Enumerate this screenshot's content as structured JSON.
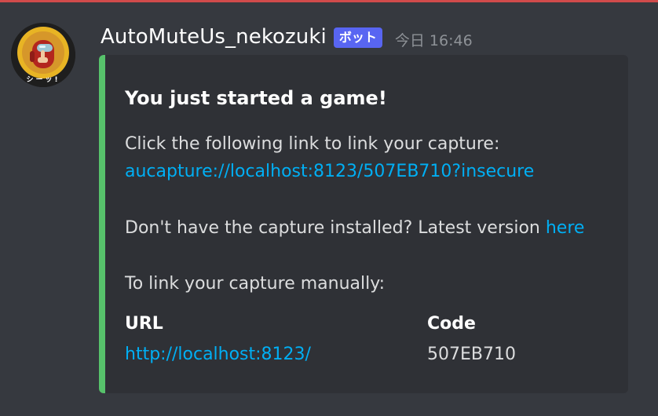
{
  "message": {
    "username": "AutoMuteUs_nekozuki",
    "bot_badge": "ボット",
    "timestamp": "今日 16:46",
    "avatar": {
      "icon": "crewmate-avatar-icon",
      "caption": "シーッ!"
    }
  },
  "embed": {
    "accent_color": "#57c26b",
    "title": "You just started a game!",
    "intro_text": "Click the following link to link your capture:",
    "capture_link": "aucapture://localhost:8123/507EB710?insecure",
    "install_text": "Don't have the capture installed? Latest version",
    "install_link": "here",
    "manual_text": "To link your capture manually:",
    "fields": [
      {
        "name": "URL",
        "value": "http://localhost:8123/",
        "is_link": true
      },
      {
        "name": "Code",
        "value": "507EB710",
        "is_link": false
      }
    ]
  },
  "colors": {
    "background": "#36393f",
    "embed_background": "#2f3136",
    "link": "#00aff4",
    "badge": "#5865f2",
    "top_rule": "#d14b4b"
  }
}
